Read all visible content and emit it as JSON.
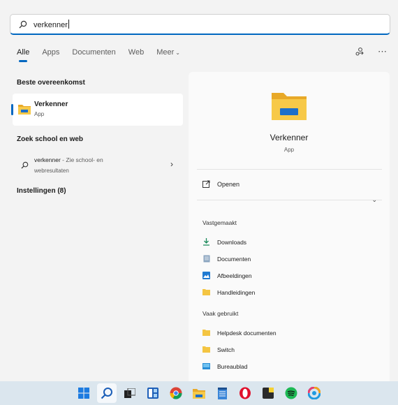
{
  "search": {
    "value": "verkenner"
  },
  "tabs": [
    {
      "label": "Alle",
      "active": true
    },
    {
      "label": "Apps"
    },
    {
      "label": "Documenten"
    },
    {
      "label": "Web"
    },
    {
      "label": "Meer"
    }
  ],
  "top_icons": [
    "share-icon",
    "more-icon"
  ],
  "left": {
    "best_match_heading": "Beste overeenkomst",
    "best_match": {
      "name": "Verkenner",
      "type": "App"
    },
    "web_heading": "Zoek school en web",
    "web_result": {
      "query": "verkenner",
      "suffix": " - Zie school- en",
      "line2": "webresultaten"
    },
    "settings_heading": "Instellingen (8)"
  },
  "right": {
    "title": "Verkenner",
    "subtitle": "App",
    "open_label": "Openen",
    "pinned_heading": "Vastgemaakt",
    "pinned": [
      {
        "label": "Downloads",
        "icon": "download-icon"
      },
      {
        "label": "Documenten",
        "icon": "document-icon"
      },
      {
        "label": "Afbeeldingen",
        "icon": "pictures-icon"
      },
      {
        "label": "Handleidingen",
        "icon": "folder-icon"
      }
    ],
    "frequent_heading": "Vaak gebruikt",
    "frequent": [
      {
        "label": "Helpdesk documenten",
        "icon": "folder-icon"
      },
      {
        "label": "Switch",
        "icon": "folder-icon"
      },
      {
        "label": "Bureaublad",
        "icon": "desktop-icon"
      }
    ]
  },
  "taskbar": [
    "windows-start-icon",
    "search-icon",
    "task-view-icon",
    "widgets-icon",
    "chrome-icon",
    "file-explorer-icon",
    "notepad-icon",
    "opera-icon",
    "sticky-notes-icon",
    "spotify-icon",
    "photos-icon"
  ],
  "colors": {
    "accent": "#0067c0",
    "folder": "#f4c542"
  }
}
